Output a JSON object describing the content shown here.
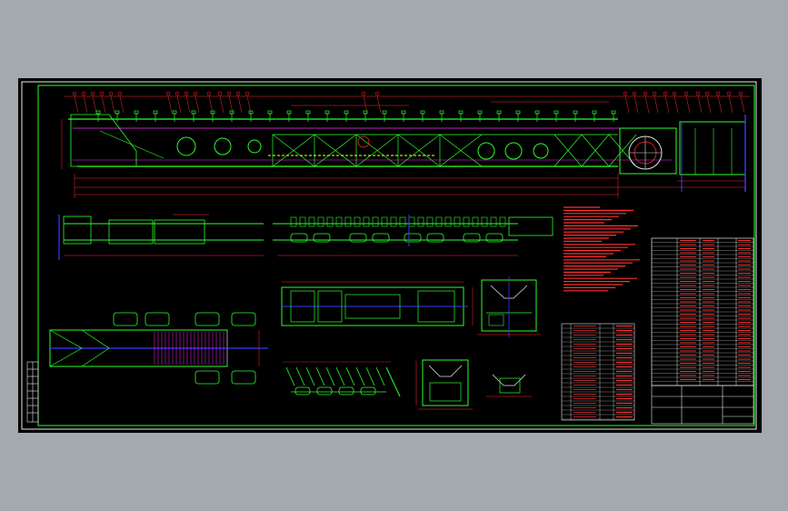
{
  "window": {
    "background": "#a4a9b0",
    "viewport_background": "#000000"
  },
  "palette": {
    "frame": "#e8e8e8",
    "border": "#2aff2a",
    "structure": "#2aff2a",
    "dimension": "#ff2a2a",
    "centerline": "#3a3aff",
    "hatch": "#ff2aff",
    "annotation": "#ff3030",
    "text_white": "#e0e0e0",
    "yellow": "#ffff30",
    "cyan": "#30ffff"
  },
  "icons": {
    "title_block": "title-block-table",
    "revision_strip": "revision-strip"
  },
  "labels": {
    "note_heading": "",
    "table_heading": ""
  }
}
